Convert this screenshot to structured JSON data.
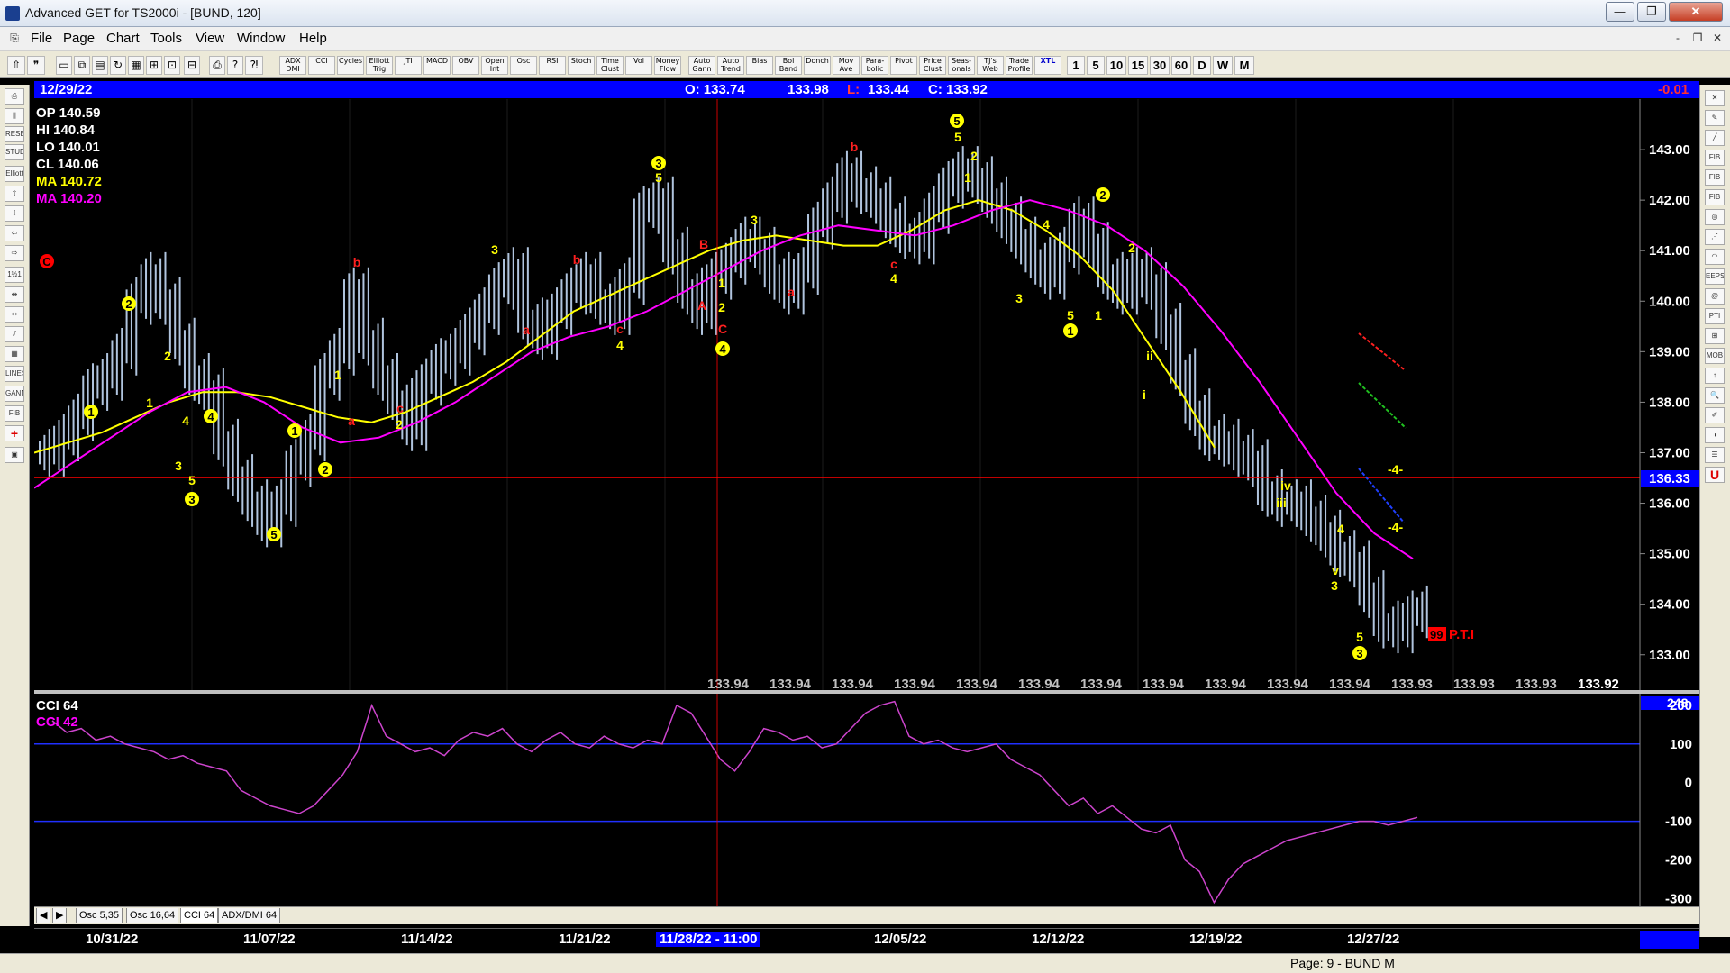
{
  "window": {
    "title": "Advanced GET for TS2000i - [BUND, 120]",
    "btn_min": "—",
    "btn_max": "❐",
    "btn_close": "✕"
  },
  "menu": {
    "items": [
      "File",
      "Page",
      "Chart",
      "Tools",
      "View",
      "Window",
      "Help"
    ],
    "mdi_min": "-",
    "mdi_restore": "❐",
    "mdi_close": "✕"
  },
  "toolbar": {
    "studies": [
      "ADX DMI",
      "CCI",
      "Cycles",
      "Elliott Trig",
      "JTI",
      "MACD",
      "OBV",
      "Open Int",
      "Osc",
      "RSI",
      "Stoch",
      "Time Clust",
      "Vol",
      "Money Flow",
      "Auto Gann",
      "Auto Trend",
      "Bias",
      "Bol Band",
      "Donch",
      "Mov Ave",
      "Para-bolic",
      "Pivot",
      "Price Clust",
      "Seas-onals",
      "TJ's Web",
      "Trade Profile",
      "XTL"
    ],
    "intervals": [
      "1",
      "5",
      "10",
      "15",
      "30",
      "60",
      "D",
      "W",
      "M"
    ]
  },
  "infobar": {
    "date": "12/29/22",
    "open": "O: 133.74",
    "high": "133.98",
    "low_label": "L:",
    "low": "133.44",
    "close": "C: 133.92",
    "change": "-0.01"
  },
  "price_panel": {
    "ohlc_labels": [
      {
        "text": "OP  140.59",
        "color": "#ffffff"
      },
      {
        "text": "HI  140.84",
        "color": "#ffffff"
      },
      {
        "text": "LO  140.01",
        "color": "#ffffff"
      },
      {
        "text": "CL  140.06",
        "color": "#ffffff"
      },
      {
        "text": "MA  140.72",
        "color": "#ffff00"
      },
      {
        "text": "MA  140.20",
        "color": "#ff00ff"
      }
    ],
    "y_ticks": [
      "143.00",
      "142.00",
      "141.00",
      "140.00",
      "139.00",
      "138.00",
      "137.00",
      "136.00",
      "135.00",
      "134.00",
      "133.00"
    ],
    "y_range": [
      132.3,
      144.0
    ],
    "current_price_tag": "136.33",
    "bottom_values": [
      "133.94",
      "133.94",
      "133.94",
      "133.94",
      "133.94",
      "133.94",
      "133.94",
      "133.94",
      "133.94",
      "133.94",
      "133.94",
      "133.93",
      "133.93",
      "133.93",
      "133.92"
    ],
    "pti_label": "P.T.I",
    "pti_value": "99",
    "target_labels": [
      "-4-",
      "-4-"
    ],
    "colors": {
      "ma_fast": "#ffff00",
      "ma_slow": "#ff00ff",
      "bars": "#b0c4de",
      "hline": "#ff0000",
      "cursor": "#ff0000"
    }
  },
  "chart_data": {
    "type": "line",
    "title": "",
    "series": [
      {
        "name": "",
        "values": [
          137.0,
          137.3,
          137.7,
          138.3,
          138.5,
          139.0,
          140.0,
          140.5,
          140.0,
          139.2,
          138.5,
          138.2,
          137.2,
          136.5,
          136.0,
          135.6,
          136.0,
          136.8,
          137.3,
          138.5,
          139.0,
          140.2,
          139.2,
          138.5,
          138.0,
          137.5,
          138.4,
          138.8,
          139.0,
          139.4,
          139.8,
          140.3,
          140.6,
          139.6,
          139.3,
          139.8,
          140.2,
          140.5,
          140.0,
          139.8,
          140.4,
          141.8,
          142.0,
          141.0,
          140.2,
          139.8,
          140.5,
          140.8,
          141.2,
          141.0,
          140.5,
          140.2,
          140.6,
          141.5,
          142.0,
          142.5,
          142.2,
          142.0,
          141.6,
          141.3,
          141.2,
          141.8,
          142.3,
          142.6,
          142.4,
          142.0,
          141.6,
          141.2,
          140.8,
          140.5,
          141.0,
          141.6,
          141.1,
          140.5,
          140.2,
          140.6,
          140.3,
          139.5,
          138.6,
          137.8,
          137.3,
          137.2,
          137.0,
          136.8,
          136.2,
          136.0,
          136.0,
          135.7,
          135.4,
          135.0,
          134.8,
          134.2,
          133.6,
          133.5,
          133.8,
          133.9
        ]
      },
      {
        "name": "",
        "values": [
          137.0,
          137.2,
          137.4,
          137.7,
          138.0,
          138.2,
          138.2,
          138.1,
          137.9,
          137.7,
          137.6,
          137.8,
          138.1,
          138.4,
          138.8,
          139.3,
          139.8,
          140.1,
          140.4,
          140.7,
          141.0,
          141.2,
          141.3,
          141.2,
          141.1,
          141.1,
          141.4,
          141.8,
          142.0,
          141.8,
          141.4,
          140.9,
          140.2,
          139.2,
          138.2,
          137.1
        ]
      },
      {
        "name": "",
        "values": [
          136.3,
          136.8,
          137.3,
          137.8,
          138.2,
          138.3,
          138.0,
          137.5,
          137.2,
          137.3,
          137.6,
          138.0,
          138.5,
          139.0,
          139.3,
          139.5,
          139.8,
          140.2,
          140.6,
          141.0,
          141.3,
          141.5,
          141.4,
          141.3,
          141.5,
          141.8,
          142.0,
          141.8,
          141.5,
          141.0,
          140.3,
          139.4,
          138.4,
          137.3,
          136.2,
          135.4,
          134.9
        ]
      }
    ],
    "ylim": [
      132.3,
      144.0
    ]
  },
  "cci_panel": {
    "labels": [
      {
        "text": "CCI 64",
        "color": "#ffffff"
      },
      {
        "text": "CCI  42",
        "color": "#ff00ff"
      }
    ],
    "value_tag": "248",
    "y_ticks": [
      "200",
      "100",
      "0",
      "-100",
      "-200",
      "-300"
    ],
    "y_range": [
      -320,
      230
    ],
    "line_color": "#cc44cc",
    "cci_values": [
      160,
      130,
      140,
      110,
      120,
      100,
      90,
      80,
      60,
      70,
      50,
      40,
      30,
      -20,
      -40,
      -60,
      -70,
      -80,
      -60,
      -20,
      20,
      80,
      200,
      120,
      100,
      80,
      90,
      70,
      110,
      130,
      120,
      140,
      100,
      80,
      110,
      130,
      100,
      90,
      120,
      100,
      90,
      110,
      100,
      200,
      180,
      120,
      60,
      30,
      80,
      140,
      130,
      110,
      120,
      90,
      100,
      140,
      180,
      200,
      210,
      120,
      100,
      110,
      90,
      80,
      90,
      100,
      60,
      40,
      20,
      -20,
      -60,
      -40,
      -80,
      -60,
      -90,
      -120,
      -130,
      -110,
      -200,
      -230,
      -310,
      -250,
      -210,
      -190,
      -170,
      -150,
      -140,
      -130,
      -120,
      -110,
      -100,
      -100,
      -110,
      -100,
      -90
    ]
  },
  "tabs": [
    "Osc 5,35",
    "Osc 16,64",
    "CCI 64",
    "ADX/DMI 64"
  ],
  "tab_arrows": [
    "◀",
    "▶"
  ],
  "dates": [
    "10/31/22",
    "11/07/22",
    "11/14/22",
    "11/21/22",
    "11/28/22 - 11:00",
    "12/05/22",
    "12/12/22",
    "12/19/22",
    "12/27/22"
  ],
  "status": {
    "text": "Page: 9 - BUND M"
  }
}
